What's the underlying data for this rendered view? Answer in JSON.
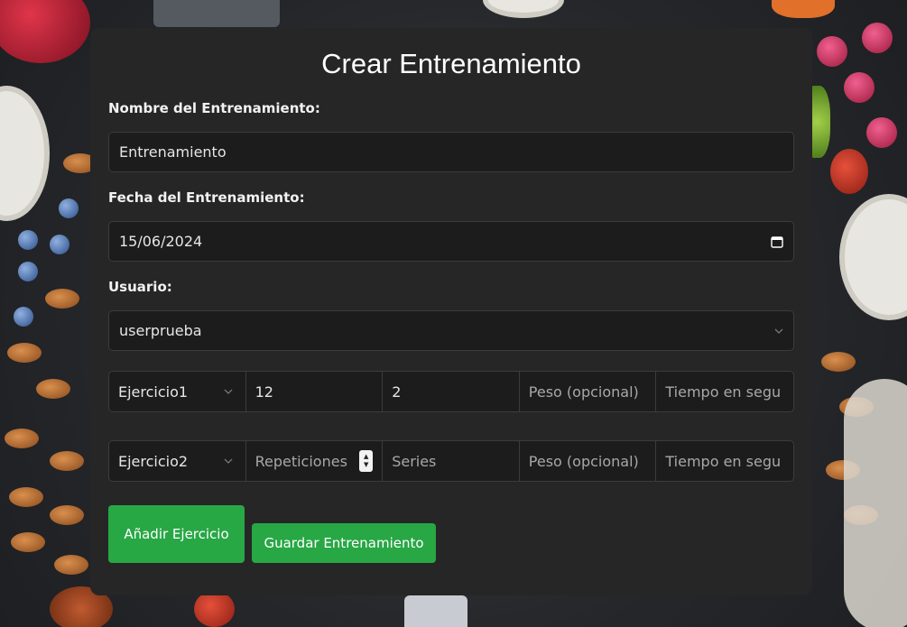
{
  "page": {
    "title": "Crear Entrenamiento"
  },
  "form": {
    "name_label": "Nombre del Entrenamiento:",
    "name_value": "Entrenamiento",
    "date_label": "Fecha del Entrenamiento:",
    "date_value": "15/06/2024",
    "user_label": "Usuario:",
    "user_value": "userprueba"
  },
  "exercises": [
    {
      "exercise": "Ejercicio1",
      "reps": "12",
      "series": "2",
      "weight_placeholder": "Peso (opcional)",
      "time_placeholder": "Tiempo en segu"
    },
    {
      "exercise": "Ejercicio2",
      "reps_placeholder": "Repeticiones",
      "series_placeholder": "Series",
      "weight_placeholder": "Peso (opcional)",
      "time_placeholder": "Tiempo en segu"
    }
  ],
  "buttons": {
    "add_exercise": "Añadir Ejercicio",
    "save_workout": "Guardar Entrenamiento"
  },
  "colors": {
    "button_green": "#28a745",
    "card_background": "#262626",
    "input_background": "#1c1c1c"
  }
}
